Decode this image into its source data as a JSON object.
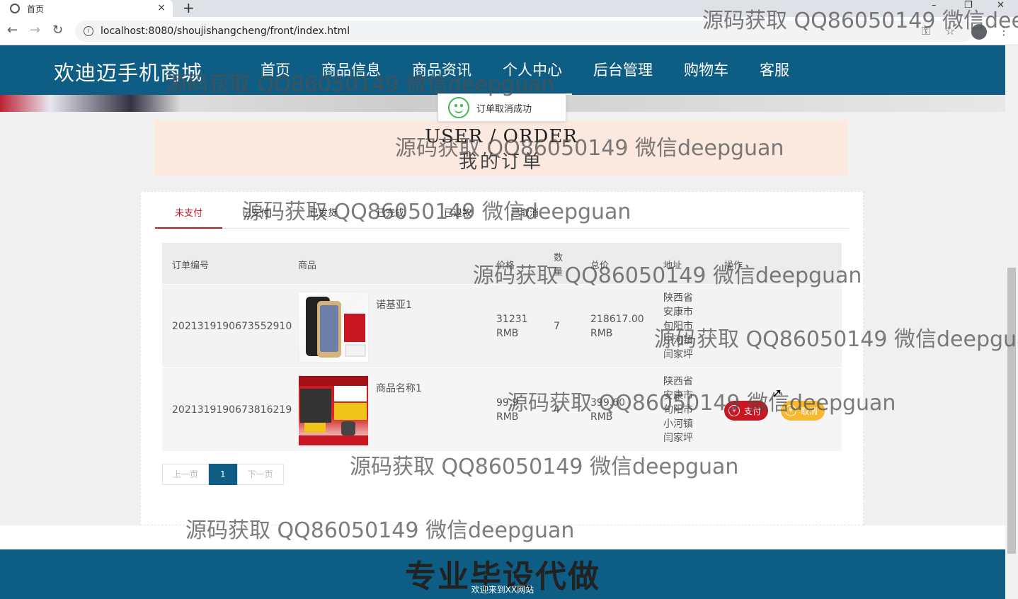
{
  "browser": {
    "tab_title": "首页",
    "tab_close": "×",
    "new_tab": "+",
    "url": "localhost:8080/shoujishangcheng/front/index.html",
    "back": "←",
    "forward": "→",
    "reload": "↻",
    "key_icon": "⚿",
    "star_icon": "☆",
    "menu_icon": "⋮",
    "min": "–",
    "max": "❐",
    "close": "✕"
  },
  "header": {
    "logo": "欢迪迈手机商城",
    "nav": [
      "首页",
      "商品信息",
      "商品资讯",
      "个人中心",
      "后台管理",
      "购物车",
      "客服"
    ],
    "active_index": 3
  },
  "toast": {
    "message": "订单取消成功"
  },
  "page_title": {
    "en": "USER / ORDER",
    "cn": "我的订单"
  },
  "tabs": {
    "items": [
      "未支付",
      "已支付",
      "已发货",
      "已完成",
      "已退款",
      "已取消"
    ],
    "active_index": 0
  },
  "table": {
    "headers": {
      "order_no": "订单编号",
      "product": "商品",
      "price": "价格",
      "qty_line1": "数",
      "qty_line2": "量",
      "total": "总价",
      "address": "地址",
      "action": "操作"
    },
    "rows": [
      {
        "order_no": "2021319190673552910",
        "product": "诺基亚1",
        "price_line1": "31231",
        "price_line2": "RMB",
        "qty": "7",
        "total_line1": "218617.00",
        "total_line2": "RMB",
        "address": [
          "陕西省",
          "安康市",
          "旬阳市",
          "小河镇",
          "闫家坪"
        ]
      },
      {
        "order_no": "2021319190673816219",
        "product": "商品名称1",
        "price_line1": "99.9",
        "price_line2": "RMB",
        "qty": "4",
        "total_line1": "399.60",
        "total_line2": "RMB",
        "address": [
          "陕西省",
          "安康市",
          "旬阳市",
          "小河镇",
          "闫家坪"
        ],
        "pay_label": "支付",
        "cancel_label": "取消"
      }
    ]
  },
  "pager": {
    "prev": "上一页",
    "current": "1",
    "next": "下一页"
  },
  "footer": {
    "big": "专业毕设代做",
    "small": "欢迎来到XX网站"
  },
  "watermark": "源码获取 QQ86050149 微信deepguan",
  "colors": {
    "primary": "#0d5d85",
    "active_red": "#c81623",
    "pay_button": "#c81623",
    "cancel_button": "#f5b82e",
    "title_bg": "#fbe8df"
  }
}
